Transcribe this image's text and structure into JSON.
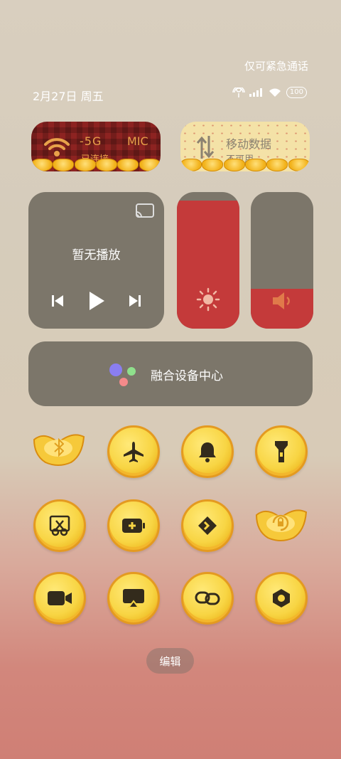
{
  "status": {
    "emergency_text": "仅可紧急通话",
    "date_text": "2月27日 周五",
    "battery": "100"
  },
  "tiles": {
    "wifi": {
      "title": "-5G",
      "title_extra": "MIC",
      "subtitle": "已连接"
    },
    "mobile_data": {
      "title": "移动数据",
      "subtitle": "不可用"
    }
  },
  "media": {
    "title": "暂无播放"
  },
  "device_center": {
    "label": "融合设备中心"
  },
  "sliders": {
    "brightness": 0.94,
    "volume": 0.29
  },
  "toggles": [
    "bluetooth",
    "airplane-mode",
    "bell",
    "flashlight",
    "screenshot",
    "battery-saver",
    "direction",
    "rotation-lock",
    "screen-record",
    "screen-cast",
    "link",
    "settings"
  ],
  "edit_label": "编辑",
  "colors": {
    "accent_red": "#c43a3a",
    "coin_gold": "#f8d544",
    "panel_gray": "#7c766a"
  }
}
